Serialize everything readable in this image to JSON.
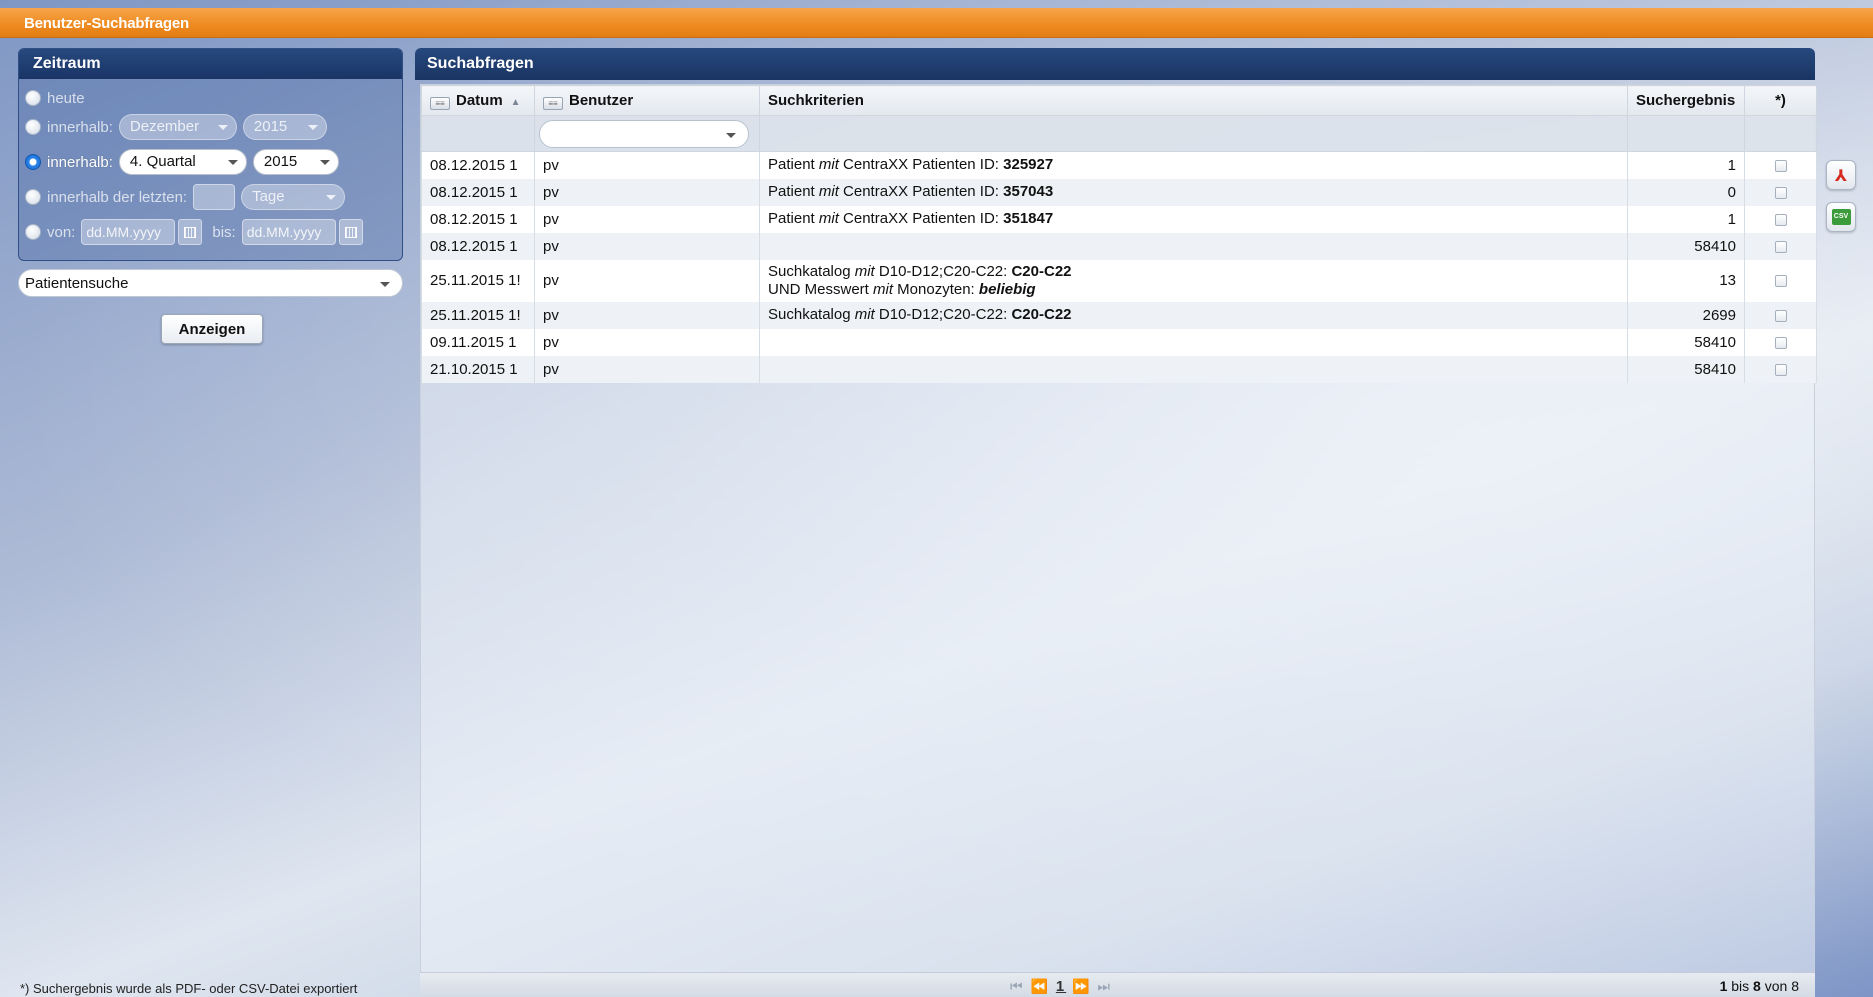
{
  "window": {
    "title": "Benutzer-Suchabfragen"
  },
  "zeitraum": {
    "title": "Zeitraum",
    "options": {
      "heute": "heute",
      "innerhalb_monat": {
        "label": "innerhalb:",
        "month": "Dezember",
        "year": "2015"
      },
      "innerhalb_quartal": {
        "label": "innerhalb:",
        "quarter": "4. Quartal",
        "year": "2015"
      },
      "letzten": {
        "label": "innerhalb der letzten:",
        "unit": "Tage"
      },
      "von_bis": {
        "von_label": "von:",
        "von_placeholder": "dd.MM.yyyy",
        "bis_label": "bis:",
        "bis_placeholder": "dd.MM.yyyy"
      }
    },
    "selected": "innerhalb_quartal"
  },
  "search_type": {
    "selected": "Patientensuche"
  },
  "show_button": "Anzeigen",
  "footnote": "*) Suchergebnis wurde als PDF- oder CSV-Datei exportiert",
  "results": {
    "title": "Suchabfragen",
    "columns": {
      "datum": "Datum",
      "benutzer": "Benutzer",
      "kriterien": "Suchkriterien",
      "ergebnis": "Suchergebnis",
      "export": "*)"
    },
    "rows": [
      {
        "datum": "08.12.2015 1",
        "benutzer": "pv",
        "crit": {
          "a": "Patient ",
          "mit": "mit",
          "b": " CentraXX Patienten ID: ",
          "val": "325927"
        },
        "ergebnis": "1"
      },
      {
        "datum": "08.12.2015 1",
        "benutzer": "pv",
        "crit": {
          "a": "Patient ",
          "mit": "mit",
          "b": " CentraXX Patienten ID: ",
          "val": "357043"
        },
        "ergebnis": "0"
      },
      {
        "datum": "08.12.2015 1",
        "benutzer": "pv",
        "crit": {
          "a": "Patient ",
          "mit": "mit",
          "b": " CentraXX Patienten ID: ",
          "val": "351847"
        },
        "ergebnis": "1"
      },
      {
        "datum": "08.12.2015 1",
        "benutzer": "pv",
        "ergebnis": "58410"
      },
      {
        "datum": "25.11.2015 1!",
        "benutzer": "pv",
        "crit2": {
          "a": "Suchkatalog ",
          "mit": "mit",
          "b": " D10-D12;C20-C22: ",
          "val": "C20-C22",
          "c": "UND Messwert ",
          "mit2": "mit",
          "d": " Monozyten: ",
          "val2": "beliebig"
        },
        "ergebnis": "13"
      },
      {
        "datum": "25.11.2015 1!",
        "benutzer": "pv",
        "crit": {
          "a": "Suchkatalog ",
          "mit": "mit",
          "b": " D10-D12;C20-C22: ",
          "val": "C20-C22"
        },
        "ergebnis": "2699"
      },
      {
        "datum": "09.11.2015 1",
        "benutzer": "pv",
        "ergebnis": "58410"
      },
      {
        "datum": "21.10.2015 1",
        "benutzer": "pv",
        "ergebnis": "58410"
      }
    ]
  },
  "pager": {
    "first": "⏮",
    "prev": "⏪",
    "current": "1",
    "next": "⏩",
    "last": "⏭",
    "from": "1",
    "bis": "bis",
    "to": "8",
    "von": "von",
    "total": "8"
  },
  "side_icons": {
    "pdf": "pdf-export-icon",
    "csv": "csv-export-icon",
    "csv_text": "CSV"
  },
  "colors": {
    "title_orange": "#ee8a1f",
    "panel_blue": "#1f3b6e",
    "radio_on": "#2a84ea"
  }
}
